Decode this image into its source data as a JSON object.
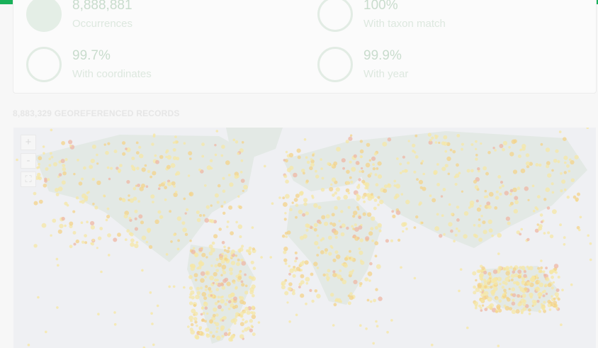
{
  "stats": {
    "occurrences": {
      "value": "8,888,881",
      "label": "Occurrences"
    },
    "taxon_match": {
      "value": "100%",
      "label": "With taxon match"
    },
    "coordinates": {
      "value": "99.7%",
      "label": "With coordinates"
    },
    "year": {
      "value": "99.9%",
      "label": "With year"
    }
  },
  "map_section": {
    "heading": "8,883,329 GEOREFERENCED RECORDS"
  },
  "map_controls": {
    "zoom_in": "+",
    "zoom_out": "-",
    "fullscreen": "⛶"
  },
  "colors": {
    "accent": "#19b15a",
    "density_low": "#f6e7a6",
    "density_mid": "#f4d38a",
    "density_high": "#efb7a4",
    "land": "#dfe7e2"
  },
  "icons": [
    "zoom-in-icon",
    "zoom-out-icon",
    "fullscreen-icon"
  ]
}
